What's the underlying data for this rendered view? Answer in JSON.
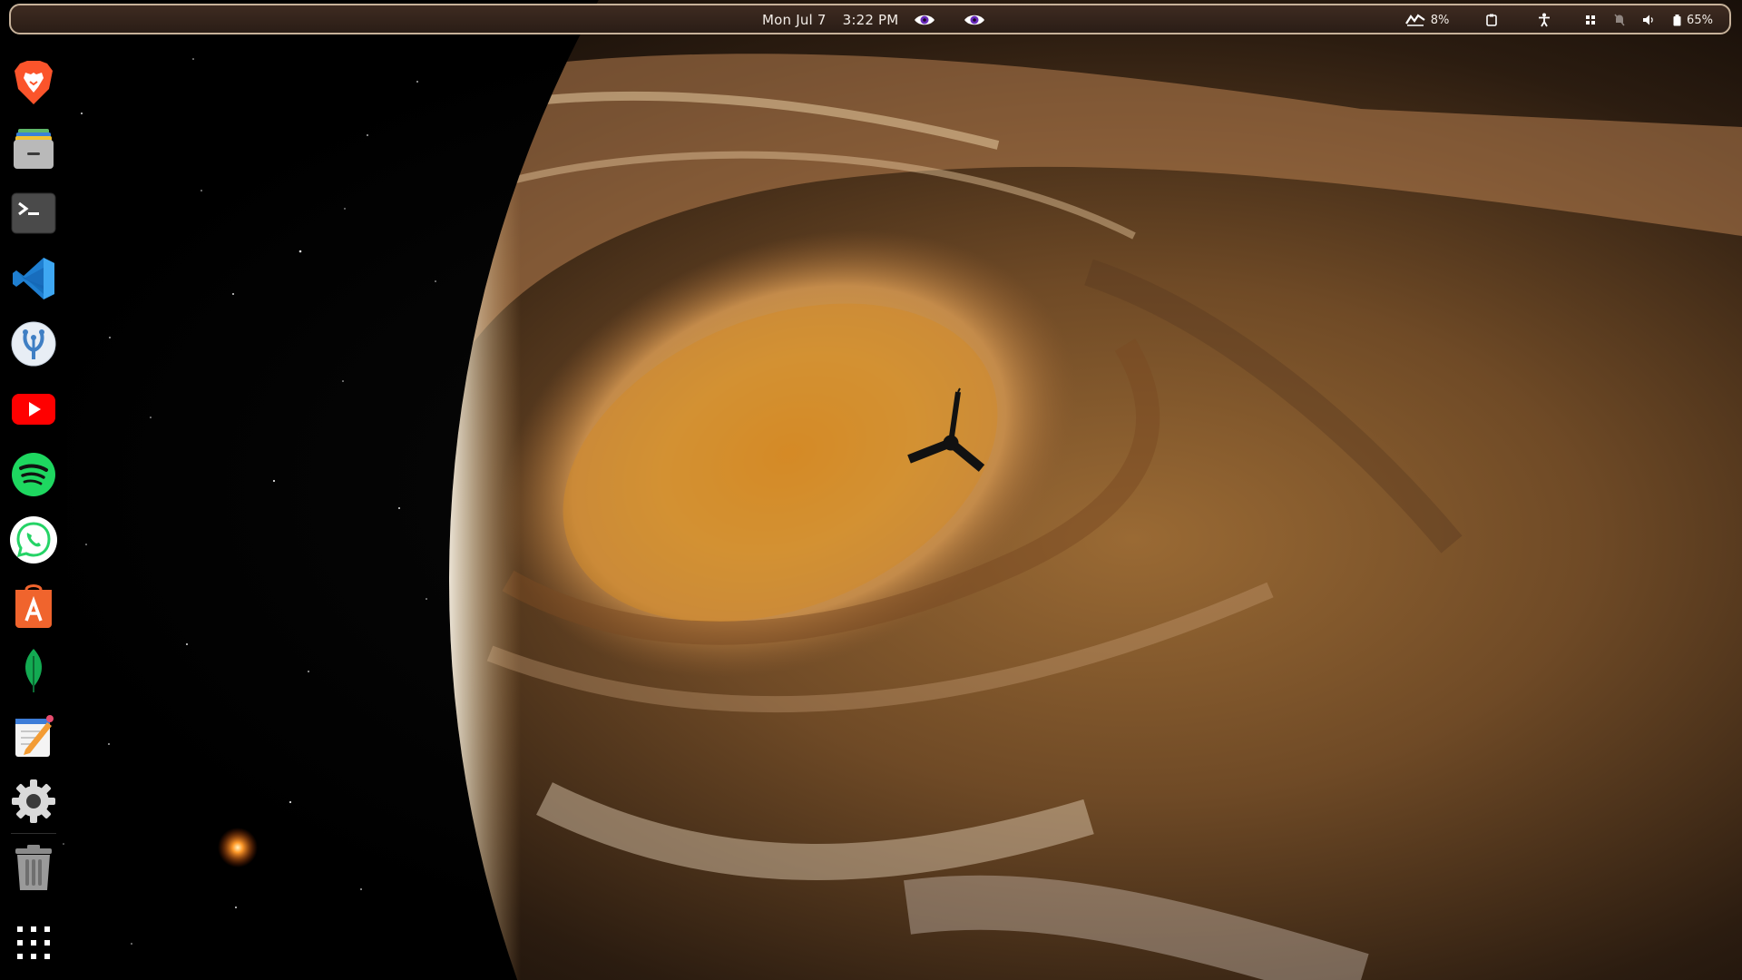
{
  "panel": {
    "date": "Mon Jul 7",
    "time": "3:22 PM",
    "cpu_percent": "8%",
    "battery_percent": "65%"
  },
  "tray_icons": [
    "eye-icon",
    "eye-icon",
    "cpu-monitor-icon",
    "clipboard-icon",
    "accessibility-icon",
    "app-grid-small-icon",
    "notifications-off-icon",
    "volume-icon",
    "battery-icon"
  ],
  "dock": {
    "apps": [
      {
        "name": "brave-browser",
        "icon": "brave-lion-icon"
      },
      {
        "name": "files",
        "icon": "file-cabinet-icon"
      },
      {
        "name": "terminal",
        "icon": "terminal-icon"
      },
      {
        "name": "visual-studio-code",
        "icon": "vscode-icon"
      },
      {
        "name": "kde-connect",
        "icon": "kde-icon"
      },
      {
        "name": "youtube",
        "icon": "youtube-icon"
      },
      {
        "name": "spotify",
        "icon": "spotify-icon"
      },
      {
        "name": "whatsapp",
        "icon": "whatsapp-icon"
      },
      {
        "name": "app-store",
        "icon": "app-store-icon"
      },
      {
        "name": "mongodb-compass",
        "icon": "mongodb-leaf-icon"
      },
      {
        "name": "text-editor",
        "icon": "text-editor-icon"
      },
      {
        "name": "settings",
        "icon": "gear-icon"
      },
      {
        "name": "trash",
        "icon": "trash-icon"
      },
      {
        "name": "show-apps",
        "icon": "grid-icon"
      }
    ]
  },
  "colors": {
    "panel_bg": "#3e2b21",
    "panel_border": "#c7b29a",
    "eye_purple": "#6a2bbd"
  }
}
